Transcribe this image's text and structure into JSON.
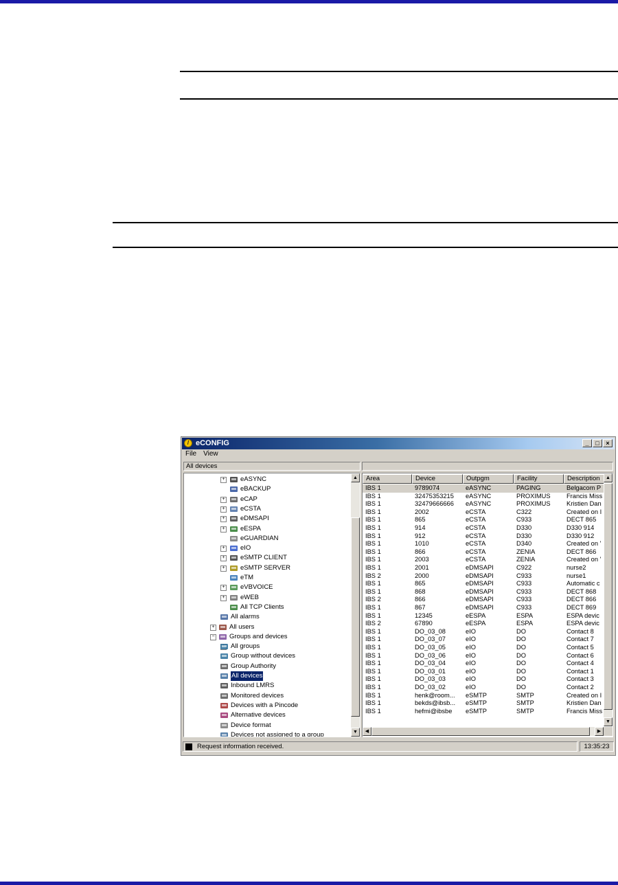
{
  "window": {
    "title": "eCONFIG",
    "minimize": "_",
    "maximize": "□",
    "close": "×"
  },
  "menu": [
    "File",
    "View"
  ],
  "path_left": "All devices",
  "path_right": "",
  "tree": [
    {
      "label": "eASYNC",
      "icon": "modem-icon",
      "expander": "+",
      "indent": 2
    },
    {
      "label": "eBACKUP",
      "icon": "backup-device-icon",
      "expander": "",
      "indent": 2
    },
    {
      "label": "eCAP",
      "icon": "pager-icon",
      "expander": "+",
      "indent": 2
    },
    {
      "label": "eCSTA",
      "icon": "computer-icon",
      "expander": "+",
      "indent": 2
    },
    {
      "label": "eDMSAPI",
      "icon": "mail-server-icon",
      "expander": "+",
      "indent": 2
    },
    {
      "label": "eESPA",
      "icon": "espa-device-icon",
      "expander": "+",
      "indent": 2
    },
    {
      "label": "eGUARDIAN",
      "icon": "guardian-icon",
      "expander": "",
      "indent": 2
    },
    {
      "label": "eIO",
      "icon": "io-module-icon",
      "expander": "+",
      "indent": 2
    },
    {
      "label": "eSMTP CLIENT",
      "icon": "smtp-client-icon",
      "expander": "+",
      "indent": 2
    },
    {
      "label": "eSMTP SERVER",
      "icon": "smtp-server-icon",
      "expander": "+",
      "indent": 2
    },
    {
      "label": "eTM",
      "icon": "telemetry-icon",
      "expander": "",
      "indent": 2
    },
    {
      "label": "eVBVOICE",
      "icon": "voice-icon",
      "expander": "+",
      "indent": 2
    },
    {
      "label": "eWEB",
      "icon": "web-gear-icon",
      "expander": "+",
      "indent": 2
    },
    {
      "label": "All TCP Clients",
      "icon": "tcp-client-icon",
      "expander": "",
      "indent": 2
    },
    {
      "label": "All alarms",
      "icon": "alarms-icon",
      "expander": "",
      "indent": 1
    },
    {
      "label": "All users",
      "icon": "users-icon",
      "expander": "+",
      "indent": 0
    },
    {
      "label": "Groups and devices",
      "icon": "groups-devices-icon",
      "expander": "−",
      "indent": 0
    },
    {
      "label": "All groups",
      "icon": "groups-icon",
      "expander": "+",
      "indent": 1
    },
    {
      "label": "Group without devices",
      "icon": "group-empty-icon",
      "expander": "",
      "indent": 1
    },
    {
      "label": "Group Authority",
      "icon": "group-authority-icon",
      "expander": "",
      "indent": 1
    },
    {
      "label": "All devices",
      "icon": "all-devices-icon",
      "expander": "",
      "indent": 1,
      "selected": true
    },
    {
      "label": "Inbound LMRS",
      "icon": "lmrs-icon",
      "expander": "",
      "indent": 1
    },
    {
      "label": "Monitored devices",
      "icon": "monitor-icon",
      "expander": "",
      "indent": 1
    },
    {
      "label": "Devices with a Pincode",
      "icon": "pincode-icon",
      "expander": "",
      "indent": 1
    },
    {
      "label": "Alternative devices",
      "icon": "alternative-icon",
      "expander": "",
      "indent": 1
    },
    {
      "label": "Device format",
      "icon": "format-icon",
      "expander": "",
      "indent": 1
    },
    {
      "label": "Devices not assigned to a group",
      "icon": "unassigned-icon",
      "expander": "",
      "indent": 1
    }
  ],
  "table": {
    "columns": [
      "Area",
      "Device",
      "Outpgm",
      "Facility",
      "Description"
    ],
    "rows": [
      [
        "IBS 1",
        "9789074",
        "eASYNC",
        "PAGING",
        "Belgacom P"
      ],
      [
        "IBS 1",
        "32475353215",
        "eASYNC",
        "PROXIMUS",
        "Francis Miss"
      ],
      [
        "IBS 1",
        "32479666666",
        "eASYNC",
        "PROXIMUS",
        "Kristien Dan"
      ],
      [
        "IBS 1",
        "2002",
        "eCSTA",
        "C322",
        "Created on I"
      ],
      [
        "IBS 1",
        "865",
        "eCSTA",
        "C933",
        "DECT 865"
      ],
      [
        "IBS 1",
        "914",
        "eCSTA",
        "D330",
        "D330 914"
      ],
      [
        "IBS 1",
        "912",
        "eCSTA",
        "D330",
        "D330 912"
      ],
      [
        "IBS 1",
        "1010",
        "eCSTA",
        "D340",
        "Created on '"
      ],
      [
        "IBS 1",
        "866",
        "eCSTA",
        "ZENIA",
        "DECT 866"
      ],
      [
        "IBS 1",
        "2003",
        "eCSTA",
        "ZENIA",
        "Created on '"
      ],
      [
        "IBS 1",
        "2001",
        "eDMSAPI",
        "C922",
        "nurse2"
      ],
      [
        "IBS 2",
        "2000",
        "eDMSAPI",
        "C933",
        "nurse1"
      ],
      [
        "IBS 1",
        "865",
        "eDMSAPI",
        "C933",
        "Automatic c"
      ],
      [
        "IBS 1",
        "868",
        "eDMSAPI",
        "C933",
        "DECT 868"
      ],
      [
        "IBS 2",
        "866",
        "eDMSAPI",
        "C933",
        "DECT 866"
      ],
      [
        "IBS 1",
        "867",
        "eDMSAPI",
        "C933",
        "DECT 869"
      ],
      [
        "IBS 1",
        "12345",
        "eESPA",
        "ESPA",
        "ESPA devic"
      ],
      [
        "IBS 2",
        "67890",
        "eESPA",
        "ESPA",
        "ESPA devic"
      ],
      [
        "IBS 1",
        "DO_03_08",
        "eIO",
        "DO",
        "Contact 8"
      ],
      [
        "IBS 1",
        "DO_03_07",
        "eIO",
        "DO",
        "Contact 7"
      ],
      [
        "IBS 1",
        "DO_03_05",
        "eIO",
        "DO",
        "Contact 5"
      ],
      [
        "IBS 1",
        "DO_03_06",
        "eIO",
        "DO",
        "Contact 6"
      ],
      [
        "IBS 1",
        "DO_03_04",
        "eIO",
        "DO",
        "Contact 4"
      ],
      [
        "IBS 1",
        "DO_03_01",
        "eIO",
        "DO",
        "Contact 1"
      ],
      [
        "IBS 1",
        "DO_03_03",
        "eIO",
        "DO",
        "Contact 3"
      ],
      [
        "IBS 1",
        "DO_03_02",
        "eIO",
        "DO",
        "Contact 2"
      ],
      [
        "IBS 1",
        "henk@room...",
        "eSMTP",
        "SMTP",
        "Created on I"
      ],
      [
        "IBS 1",
        "bekds@ibsb...",
        "eSMTP",
        "SMTP",
        "Kristien Dan"
      ],
      [
        "IBS 1",
        "hefmi@ibsbe",
        "eSMTP",
        "SMTP",
        "Francis Miss"
      ]
    ]
  },
  "status": {
    "message": "Request information received.",
    "time": "13:35:23"
  },
  "colors": {
    "page_bar": "#1a1aa6",
    "title_gradient_start": "#0a246a",
    "selection": "#0a246a"
  }
}
